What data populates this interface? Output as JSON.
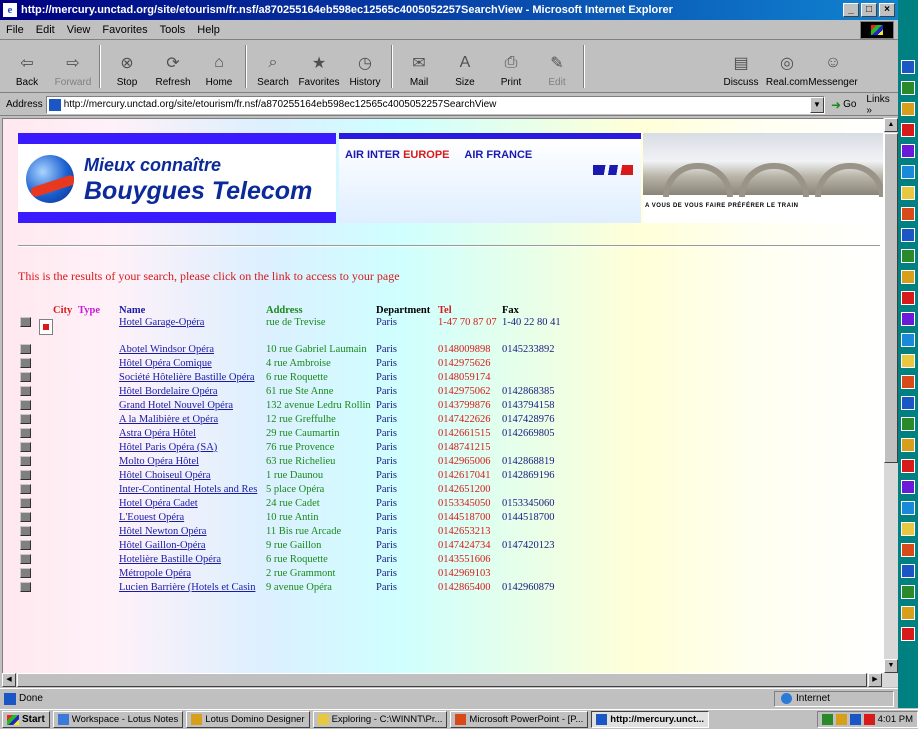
{
  "window": {
    "title": "http://mercury.unctad.org/site/etourism/fr.nsf/a870255164eb598ec12565c4005052257SearchView - Microsoft Internet Explorer",
    "min": "_",
    "max": "□",
    "close": "×"
  },
  "menu": [
    "File",
    "Edit",
    "View",
    "Favorites",
    "Tools",
    "Help"
  ],
  "toolbar": [
    {
      "label": "Back",
      "icon": "back-arrow-icon",
      "glyph": "⇦"
    },
    {
      "label": "Forward",
      "icon": "forward-arrow-icon",
      "glyph": "⇨",
      "disabled": true
    },
    {
      "label": "Stop",
      "icon": "stop-icon",
      "glyph": "⊗"
    },
    {
      "label": "Refresh",
      "icon": "refresh-icon",
      "glyph": "⟳"
    },
    {
      "label": "Home",
      "icon": "home-icon",
      "glyph": "⌂"
    },
    {
      "label": "Search",
      "icon": "search-icon",
      "glyph": "⌕"
    },
    {
      "label": "Favorites",
      "icon": "favorites-icon",
      "glyph": "★"
    },
    {
      "label": "History",
      "icon": "history-icon",
      "glyph": "◷"
    },
    {
      "label": "Mail",
      "icon": "mail-icon",
      "glyph": "✉"
    },
    {
      "label": "Size",
      "icon": "font-size-icon",
      "glyph": "A"
    },
    {
      "label": "Print",
      "icon": "print-icon",
      "glyph": "⎙"
    },
    {
      "label": "Edit",
      "icon": "edit-icon",
      "glyph": "✎",
      "disabled": true
    },
    {
      "label": "Discuss",
      "icon": "discuss-icon",
      "glyph": "▤"
    },
    {
      "label": "Real.com",
      "icon": "realcom-icon",
      "glyph": "◎"
    },
    {
      "label": "Messenger",
      "icon": "messenger-icon",
      "glyph": "☺"
    }
  ],
  "address": {
    "label": "Address",
    "value": "http://mercury.unctad.org/site/etourism/fr.nsf/a870255164eb598ec12565c4005052257SearchView",
    "go": "Go",
    "links": "Links »"
  },
  "banners": {
    "bouygues_line1": "Mieux connaître",
    "bouygues_line2": "Bouygues Telecom",
    "airinter": "AIR INTER",
    "europe": "EUROPE",
    "airfrance": "AIR FRANCE",
    "train_tagline": "A VOUS DE VOUS FAIRE PRÉFÉRER LE TRAIN"
  },
  "results_message": "This is the results of your search, please click on the link to access to your page",
  "table": {
    "headers": {
      "city": "City",
      "type": "Type",
      "name": "Name",
      "address": "Address",
      "department": "Department",
      "tel": "Tel",
      "fax": "Fax"
    },
    "rows": [
      {
        "name": "Hotel Garage-Opéra",
        "address": "rue de Trevise",
        "department": "Paris",
        "tel": "1-47 70 87 07",
        "fax": "1-40 22 80 41"
      },
      {
        "name": "Abotel Windsor Opéra",
        "address": "10 rue Gabriel Laumain",
        "department": "Paris",
        "tel": "0148009898",
        "fax": "0145233892"
      },
      {
        "name": "Hôtel Opéra Comique",
        "address": "4 rue Ambroise",
        "department": "Paris",
        "tel": "0142975626",
        "fax": ""
      },
      {
        "name": "Société Hôtelière Bastille Opéra",
        "address": "6 rue Roquette",
        "department": "Paris",
        "tel": "0148059174",
        "fax": ""
      },
      {
        "name": "Hôtel Bordelaire Opéra",
        "address": "61 rue Ste Anne",
        "department": "Paris",
        "tel": "0142975062",
        "fax": "0142868385"
      },
      {
        "name": "Grand Hotel Nouvel Opéra",
        "address": "132 avenue Ledru Rollin",
        "department": "Paris",
        "tel": "0143799876",
        "fax": "0143794158"
      },
      {
        "name": "A la Malibière et Opéra",
        "address": "12 rue Greffulhe",
        "department": "Paris",
        "tel": "0147422626",
        "fax": "0147428976"
      },
      {
        "name": "Astra Opéra Hôtel",
        "address": "29 rue Caumartin",
        "department": "Paris",
        "tel": "0142661515",
        "fax": "0142669805"
      },
      {
        "name": "Hôtel Paris Opéra (SA)",
        "address": "76 rue Provence",
        "department": "Paris",
        "tel": "0148741215",
        "fax": ""
      },
      {
        "name": "Molto Opéra Hôtel",
        "address": "63 rue Richelieu",
        "department": "Paris",
        "tel": "0142965006",
        "fax": "0142868819"
      },
      {
        "name": "Hôtel Choiseul Opéra",
        "address": "1 rue Daunou",
        "department": "Paris",
        "tel": "0142617041",
        "fax": "0142869196"
      },
      {
        "name": "Inter-Continental Hotels and Res",
        "address": "5 place Opéra",
        "department": "Paris",
        "tel": "0142651200",
        "fax": ""
      },
      {
        "name": "Hotel Opéra Cadet",
        "address": "24 rue Cadet",
        "department": "Paris",
        "tel": "0153345050",
        "fax": "0153345060"
      },
      {
        "name": "L'Eouest Opéra",
        "address": "10 rue Antin",
        "department": "Paris",
        "tel": "0144518700",
        "fax": "0144518700"
      },
      {
        "name": "Hôtel Newton Opéra",
        "address": "11 Bis rue Arcade",
        "department": "Paris",
        "tel": "0142653213",
        "fax": ""
      },
      {
        "name": "Hôtel Gaillon-Opéra",
        "address": "9 rue Gaillon",
        "department": "Paris",
        "tel": "0147424734",
        "fax": "0147420123"
      },
      {
        "name": "Hotelière Bastille Opéra",
        "address": "6 rue Roquette",
        "department": "Paris",
        "tel": "0143551606",
        "fax": ""
      },
      {
        "name": "Métropole Opéra",
        "address": "2 rue Grammont",
        "department": "Paris",
        "tel": "0142969103",
        "fax": ""
      },
      {
        "name": "Lucien Barrière (Hotels et Casin",
        "address": "9 avenue Opéra",
        "department": "Paris",
        "tel": "0142865400",
        "fax": "0142960879"
      }
    ]
  },
  "status": {
    "text": "Done",
    "zone": "Internet"
  },
  "taskbar": {
    "start": "Start",
    "tasks": [
      {
        "label": "Workspace - Lotus Notes",
        "icon": "lotus-notes-icon",
        "color": "#3a7ad8"
      },
      {
        "label": "Lotus Domino Designer",
        "icon": "domino-designer-icon",
        "color": "#d8a01a"
      },
      {
        "label": "Exploring - C:\\WINNT\\Pr...",
        "icon": "explorer-folder-icon",
        "color": "#e8c840"
      },
      {
        "label": "Microsoft PowerPoint - [P...",
        "icon": "powerpoint-icon",
        "color": "#d84a1a"
      },
      {
        "label": "http://mercury.unct...",
        "icon": "ie-icon",
        "color": "#1a56c4",
        "active": true
      }
    ],
    "clock": "4:01 PM"
  }
}
